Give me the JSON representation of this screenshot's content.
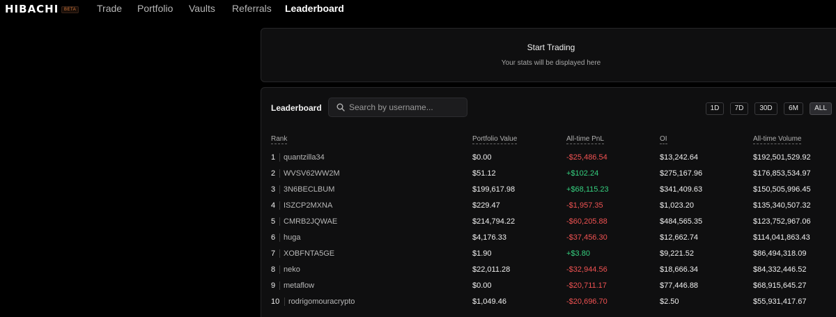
{
  "nav": {
    "logo": "HIBACHI",
    "beta": "BETA",
    "links": [
      "Trade",
      "Portfolio",
      "Vaults",
      "Referrals",
      "Leaderboard"
    ],
    "active": "Leaderboard"
  },
  "stats_card": {
    "title": "Start Trading",
    "subtitle": "Your stats will be displayed here"
  },
  "leaderboard": {
    "title": "Leaderboard",
    "search_placeholder": "Search by username...",
    "ranges": [
      "1D",
      "7D",
      "30D",
      "6M",
      "ALL"
    ],
    "active_range": "ALL",
    "columns": {
      "rank": "Rank",
      "portfolio_value": "Portfolio Value",
      "pnl": "All-time PnL",
      "oi": "OI",
      "volume": "All-time Volume"
    },
    "rows": [
      {
        "rank": "1",
        "user": "quantzilla34",
        "pv": "$0.00",
        "pnl": "-$25,486.54",
        "oi": "$13,242.64",
        "vol": "$192,501,529.92"
      },
      {
        "rank": "2",
        "user": "WVSV62WW2M",
        "pv": "$51.12",
        "pnl": "+$102.24",
        "oi": "$275,167.96",
        "vol": "$176,853,534.97"
      },
      {
        "rank": "3",
        "user": "3N6BECLBUM",
        "pv": "$199,617.98",
        "pnl": "+$68,115.23",
        "oi": "$341,409.63",
        "vol": "$150,505,996.45"
      },
      {
        "rank": "4",
        "user": "ISZCP2MXNA",
        "pv": "$229.47",
        "pnl": "-$1,957.35",
        "oi": "$1,023.20",
        "vol": "$135,340,507.32"
      },
      {
        "rank": "5",
        "user": "CMRB2JQWAE",
        "pv": "$214,794.22",
        "pnl": "-$60,205.88",
        "oi": "$484,565.35",
        "vol": "$123,752,967.06"
      },
      {
        "rank": "6",
        "user": "huga",
        "pv": "$4,176.33",
        "pnl": "-$37,456.30",
        "oi": "$12,662.74",
        "vol": "$114,041,863.43"
      },
      {
        "rank": "7",
        "user": "XOBFNTA5GE",
        "pv": "$1.90",
        "pnl": "+$3.80",
        "oi": "$9,221.52",
        "vol": "$86,494,318.09"
      },
      {
        "rank": "8",
        "user": "neko",
        "pv": "$22,011.28",
        "pnl": "-$32,944.56",
        "oi": "$18,666.34",
        "vol": "$84,332,446.52"
      },
      {
        "rank": "9",
        "user": "metaflow",
        "pv": "$0.00",
        "pnl": "-$20,711.17",
        "oi": "$77,446.88",
        "vol": "$68,915,645.27"
      },
      {
        "rank": "10",
        "user": "rodrigomouracrypto",
        "pv": "$1,049.46",
        "pnl": "-$20,696.70",
        "oi": "$2.50",
        "vol": "$55,931,417.67"
      }
    ]
  },
  "colors": {
    "positive": "#35d07f",
    "negative": "#f05252",
    "panel": "#0f0f10",
    "beta_accent": "#d97a3a"
  },
  "icons": {
    "search": "search-icon"
  }
}
